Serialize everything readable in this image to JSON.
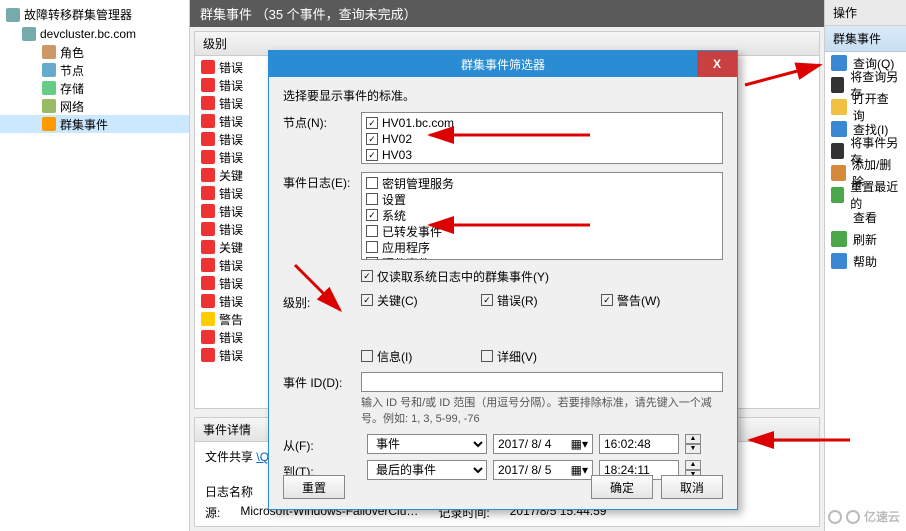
{
  "tree": {
    "root": "故障转移群集管理器",
    "cluster": "devcluster.bc.com",
    "items": [
      "角色",
      "节点",
      "存储",
      "网络",
      "群集事件"
    ]
  },
  "middle": {
    "header": "群集事件     （35 个事件，查询未完成）",
    "level_label": "级别",
    "events": [
      "错误",
      "错误",
      "错误",
      "错误",
      "错误",
      "错误",
      "关键",
      "错误",
      "错误",
      "错误",
      "关键",
      "错误",
      "错误",
      "错误",
      "警告",
      "错误",
      "错误"
    ],
    "detail_header": "事件详情",
    "share_label": "文件共享",
    "share_link": "\\Quarm\\",
    "log_name_label": "日志名称",
    "source_label": "源:",
    "source_value": "Microsoft-Windows-FailoverClu…",
    "logtime_label": "记录时间:",
    "logtime_value": "2017/8/5 15:44:59"
  },
  "actions": {
    "title": "操作",
    "subtitle": "群集事件",
    "items": [
      {
        "icon": "#3a87d4",
        "label": "查询(Q)"
      },
      {
        "icon": "#333",
        "label": "将查询另存"
      },
      {
        "icon": "#f0c040",
        "label": "打开查询"
      },
      {
        "icon": "#3a87d4",
        "label": "查找(I)"
      },
      {
        "icon": "#333",
        "label": "将事件另存"
      },
      {
        "icon": "#d48a3a",
        "label": "添加/删除"
      },
      {
        "icon": "#4aa84a",
        "label": "重置最近的"
      },
      {
        "icon": "",
        "label": "查看"
      },
      {
        "icon": "#4aa84a",
        "label": "刷新"
      },
      {
        "icon": "#3a87d4",
        "label": "帮助"
      }
    ]
  },
  "dialog": {
    "title": "群集事件筛选器",
    "prompt": "选择要显示事件的标准。",
    "node_label": "节点(N):",
    "nodes": [
      {
        "label": "HV01.bc.com",
        "checked": true
      },
      {
        "label": "HV02",
        "checked": true
      },
      {
        "label": "HV03",
        "checked": true
      }
    ],
    "log_label": "事件日志(E):",
    "logs": [
      {
        "label": "密钥管理服务",
        "checked": false
      },
      {
        "label": "设置",
        "checked": false
      },
      {
        "label": "系统",
        "checked": true
      },
      {
        "label": "已转发事件",
        "checked": false
      },
      {
        "label": "应用程序",
        "checked": false
      },
      {
        "label": "硬件事件",
        "checked": false
      }
    ],
    "only_cluster": {
      "label": "仅读取系统日志中的群集事件(Y)",
      "checked": true
    },
    "level_label": "级别:",
    "levels": [
      {
        "label": "关键(C)",
        "checked": true
      },
      {
        "label": "错误(R)",
        "checked": true
      },
      {
        "label": "警告(W)",
        "checked": true
      },
      {
        "label": "信息(I)",
        "checked": false
      },
      {
        "label": "详细(V)",
        "checked": false
      }
    ],
    "eventid_label": "事件 ID(D):",
    "eventid_hint": "输入 ID 号和/或 ID 范围（用逗号分隔）。若要排除标准，请先键入一个减号。例如: 1, 3, 5-99, -76",
    "from_label": "从(F):",
    "to_label": "到(T):",
    "from_mode": "事件",
    "to_mode": "最后的事件",
    "from_date": "2017/ 8/ 4",
    "to_date": "2017/ 8/ 5",
    "from_time": "16:02:48",
    "to_time": "18:24:11",
    "reset": "重置",
    "ok": "确定",
    "cancel": "取消"
  },
  "watermark": "亿速云"
}
